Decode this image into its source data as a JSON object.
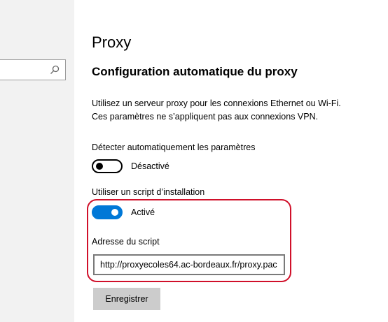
{
  "sidebar": {
    "search": {
      "value": "",
      "placeholder": ""
    }
  },
  "main": {
    "title": "Proxy",
    "section_title": "Configuration automatique du proxy",
    "description_line1": "Utilisez un serveur proxy pour les connexions Ethernet ou Wi-Fi.",
    "description_line2": "Ces paramètres ne s’appliquent pas aux connexions VPN.",
    "auto_detect": {
      "label": "Détecter automatiquement les paramètres",
      "state_label": "Désactivé",
      "enabled": false
    },
    "setup_script": {
      "label": "Utiliser un script d’installation",
      "state_label": "Activé",
      "enabled": true
    },
    "script_address": {
      "label": "Adresse du script",
      "value": "http://proxyecoles64.ac-bordeaux.fr/proxy.pac"
    },
    "save_label": "Enregistrer"
  },
  "colors": {
    "accent": "#0078d7",
    "highlight": "#d0102a",
    "sidebar_bg": "#f2f2f2",
    "button_bg": "#cccccc"
  }
}
